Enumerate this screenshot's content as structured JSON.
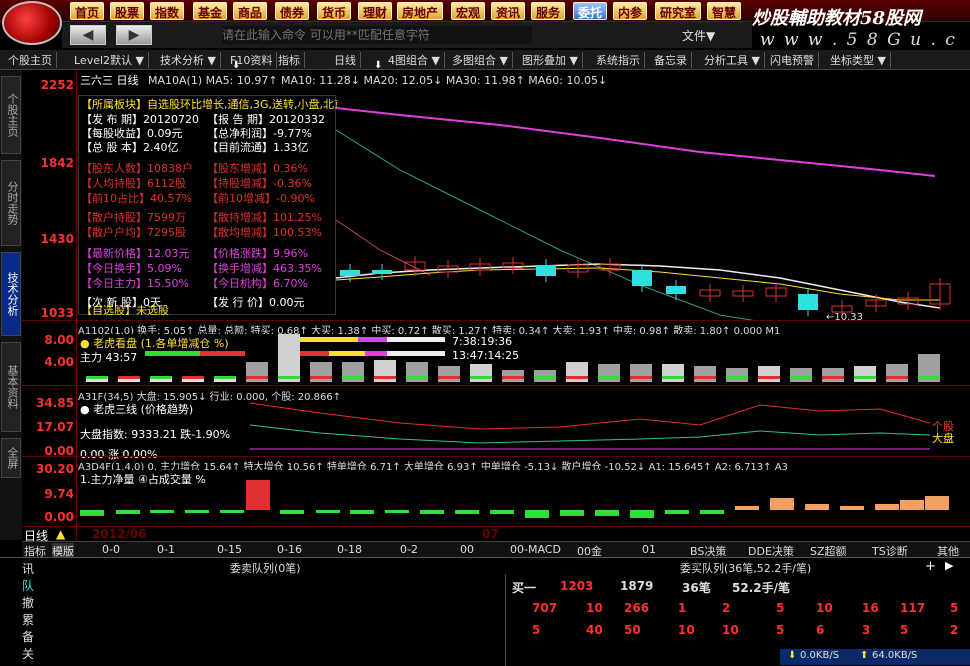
{
  "nav": [
    "首页",
    "股票",
    "指数",
    "基金",
    "商品",
    "债券",
    "货币",
    "理财",
    "房地产",
    "宏观",
    "资讯",
    "服务",
    "委托",
    "内参",
    "研究室",
    "智慧"
  ],
  "nav_active": 12,
  "brand": {
    "title": "炒股輔助教材58股网",
    "url": "w w w . 5 8 G u . c o m"
  },
  "command": {
    "placeholder": "请在此输入命令 可以用**匹配任意字符",
    "file_menu": "文件▼"
  },
  "toolbar": [
    "个股主页",
    "Level2默认 ▼",
    "技术分析 ▼",
    "F10资料",
    "指标",
    "日线",
    "4图组合 ▼",
    "多图组合 ▼",
    "图形叠加 ▼",
    "系统指示",
    "备忘录",
    "分析工具 ▼",
    "闪电预警",
    "坐标类型 ▼"
  ],
  "left_tabs": [
    "个股主页",
    "分时走势",
    "技术分析",
    "基本资料",
    "全屏"
  ],
  "left_active": 2,
  "chart_header": {
    "stock": "三六三 日线",
    "ma": "MA10A(1) MA5: 10.97↑ MA10: 11.28↓ MA20: 12.05↓ MA30: 11.98↑ MA60: 10.05↓"
  },
  "price_labels": [
    "2252",
    "1842",
    "1430",
    "1033"
  ],
  "info": {
    "sector": "【所属板块】自选股环比增长,通信,3G,送转,小盘,北京,通信服务业",
    "rows": [
      [
        "【发 布 期】20120720",
        "【报 告 期】20120332"
      ],
      [
        "【每股收益】0.09元",
        "【总净利润】-9.77%"
      ],
      [
        "【总 股 本】2.40亿",
        "【目前流通】1.33亿"
      ],
      [
        "【股东人数】10838户",
        "【股东增减】0.36%"
      ],
      [
        "【人均持股】6112股",
        "【持股增减】-0.36%"
      ],
      [
        "【前10占比】40.57%",
        "【前10增减】-0.90%"
      ],
      [
        "【散户持股】7599万",
        "【散持增减】101.25%"
      ],
      [
        "【散户户均】7295股",
        "【散均增减】100.53%"
      ],
      [
        "【最新价格】12.03元",
        "【价格涨跌】9.96%"
      ],
      [
        "【今日换手】5.09%",
        "【换手增减】463.35%"
      ],
      [
        "【今日主力】15.50%",
        "【今日机构】6.70%"
      ],
      [
        "【次 新 股】0天",
        "【发 行 价】0.00元"
      ]
    ],
    "footer": "【自选股】未选股"
  },
  "panel1": {
    "header": "A1102(1,0) 换手: 5.05↑ 总量: 总额: 特买: 0.68↑ 大买: 1.38↑ 中买: 0.72↑ 散买: 1.27↑ 特卖: 0.34↑ 大卖: 1.93↑ 中卖: 0.98↑ 散卖: 1.80↑ 0.000 M1",
    "legend": "老虎看盘 (1.各单增减仓 %)",
    "main_label": "主力 43:57",
    "time1": "7:38:19:36",
    "time2": "13:47:14:25",
    "labels": [
      "8.00",
      "4.00"
    ]
  },
  "panel2": {
    "header": "A31F(34,5) 大盘: 15.905↓ 行业: 0.000, 个股: 20.866↑",
    "legend": "老虎三线 (价格趋势)",
    "index_line": "大盘指数: 9333.21 跌-1.90%",
    "zero_line": "0.00 涨 0.00%",
    "labels": [
      "34.85",
      "17.07",
      "0.00"
    ],
    "right_labels": [
      "个股",
      "大盘"
    ]
  },
  "panel3": {
    "header": "A3D4F(1,4,0) 0, 主力增仓 15.64↑ 特大增仓 10.56↑ 特单增仓 6.71↑ 大单增仓 6.93↑ 中单增仓 -5.13↓ 散户增仓 -10.52↓ A1: 15.645↑ A2: 6.713↑ A3",
    "legend": "1.主力净量 ④占成交量 %",
    "labels": [
      "30.20",
      "9.74",
      "0.00"
    ]
  },
  "date_bar": {
    "period": "日线",
    "year": "2012/06",
    "month": "07"
  },
  "bottom_tabs": [
    "指标",
    "模版",
    "0-0",
    "0-1",
    "0-15",
    "0-16",
    "0-18",
    "0-2",
    "00",
    "00-MACD",
    "00金",
    "01",
    "BS决策",
    "DDE决策",
    "SZ超额",
    "TS诊断",
    "其他"
  ],
  "queue": {
    "side_tabs": [
      "讯",
      "队",
      "撤",
      "累",
      "备",
      "关"
    ],
    "sell_title": "委卖队列(0笔)",
    "buy_title": "委买队列(36笔,52.2手/笔)",
    "buy_head": [
      "买一",
      "1203",
      "1879",
      "36笔",
      "52.2手/笔"
    ],
    "row1": [
      "707",
      "10",
      "266",
      "1",
      "2",
      "5",
      "10",
      "16",
      "117",
      "5"
    ],
    "row2": [
      "5",
      "40",
      "50",
      "10",
      "10",
      "5",
      "6",
      "3",
      "5",
      "2"
    ],
    "status": [
      "0.0KB/S",
      "64.0KB/S"
    ]
  },
  "colors": {
    "bg": "#000000",
    "up": "#ff3030",
    "down": "#30e0e0",
    "ma20": "#e040e0",
    "ma30": "#30c0a0",
    "yellow": "#ffe030"
  }
}
